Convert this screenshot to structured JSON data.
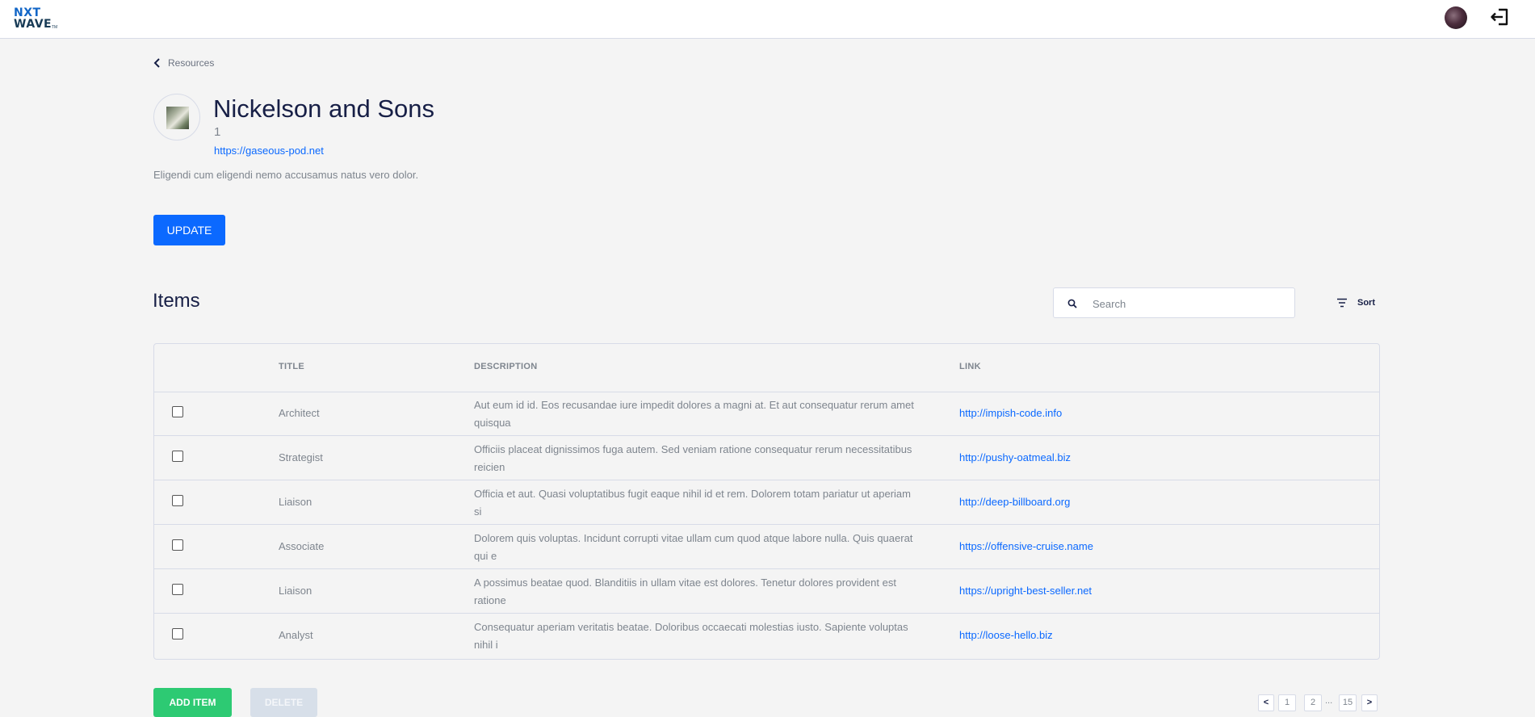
{
  "header": {
    "logo_line1": "NXT",
    "logo_line2": "WAVE",
    "logo_tm": "TM"
  },
  "breadcrumb": {
    "back_label": "Resources"
  },
  "resource": {
    "title": "Nickelson and Sons",
    "count": "1",
    "link": "https://gaseous-pod.net",
    "description": "Eligendi cum eligendi nemo accusamus natus vero dolor.",
    "update_label": "UPDATE"
  },
  "items": {
    "heading": "Items",
    "search_placeholder": "Search",
    "sort_label": "Sort",
    "columns": {
      "title": "TITLE",
      "description": "DESCRIPTION",
      "link": "LINK"
    },
    "rows": [
      {
        "title": "Architect",
        "description": "Aut eum id id. Eos recusandae iure impedit dolores a magni at. Et aut consequatur rerum amet quisqua",
        "link": "http://impish-code.info"
      },
      {
        "title": "Strategist",
        "description": "Officiis placeat dignissimos fuga autem. Sed veniam ratione consequatur rerum necessitatibus reicien",
        "link": "http://pushy-oatmeal.biz"
      },
      {
        "title": "Liaison",
        "description": "Officia et aut. Quasi voluptatibus fugit eaque nihil id et rem. Dolorem totam pariatur ut aperiam si",
        "link": "http://deep-billboard.org"
      },
      {
        "title": "Associate",
        "description": "Dolorem quis voluptas. Incidunt corrupti vitae ullam cum quod atque labore nulla. Quis quaerat qui e",
        "link": "https://offensive-cruise.name"
      },
      {
        "title": "Liaison",
        "description": "A possimus beatae quod. Blanditiis in ullam vitae est dolores. Tenetur dolores provident est ratione",
        "link": "https://upright-best-seller.net"
      },
      {
        "title": "Analyst",
        "description": "Consequatur aperiam veritatis beatae. Doloribus occaecati molestias iusto. Sapiente voluptas nihil i",
        "link": "http://loose-hello.biz"
      }
    ],
    "add_label": "ADD ITEM",
    "delete_label": "DELETE"
  },
  "pagination": {
    "prev": "<",
    "pages": [
      "1",
      "2"
    ],
    "ellipsis": "...",
    "last": "15",
    "next": ">"
  },
  "colors": {
    "primary": "#0b69ff",
    "add_button": "#2dca73",
    "delete_disabled": "#d7dfe9",
    "heading": "#171f46",
    "muted_text": "#7e858e",
    "background": "#f4f4f4",
    "border": "#d7dbe7"
  },
  "icons": [
    "logout-icon",
    "chevron-left-icon",
    "search-icon",
    "sort-icon"
  ]
}
